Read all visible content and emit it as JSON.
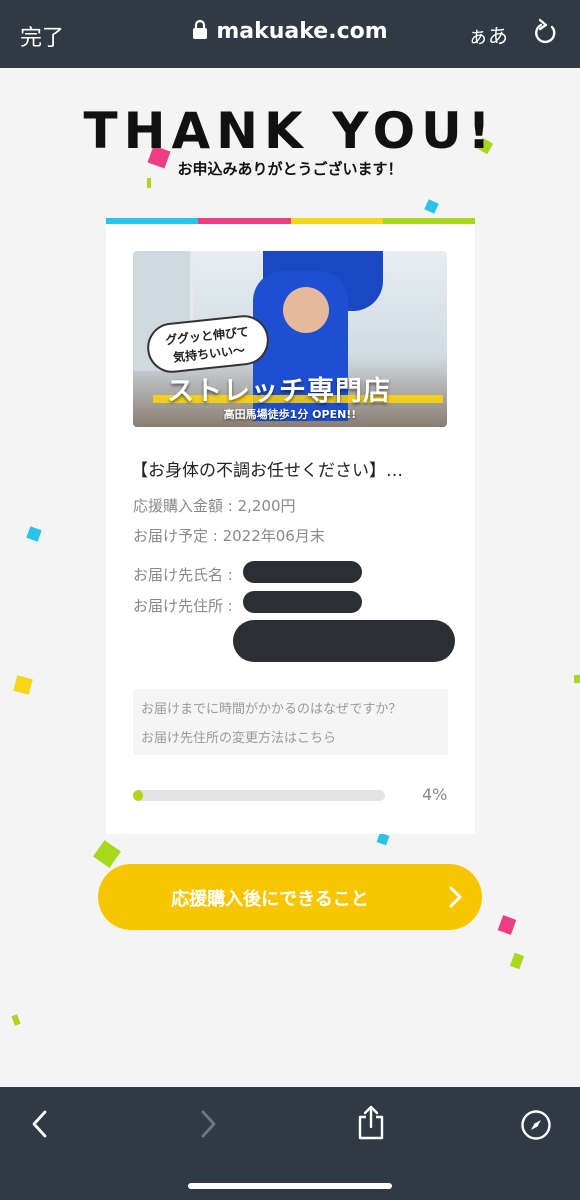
{
  "browser": {
    "done_label": "完了",
    "url": "makuake.com",
    "aa_label": "ぁあ",
    "icons": [
      "lock-icon",
      "reload-icon",
      "back-icon",
      "forward-icon",
      "share-icon",
      "compass-icon"
    ]
  },
  "heading": {
    "title": "THANK YOU!",
    "subtitle": "お申込みありがとうございます！"
  },
  "card": {
    "image": {
      "bubble_line1": "ググッと伸びて",
      "bubble_line2": "気持ちいい〜",
      "title": "ストレッチ専門店",
      "subtitle": "高田馬場徒歩1分 OPEN!!"
    },
    "project_title": "【お身体の不調お任せください】…",
    "amount": "応援購入金額 : 2,200円",
    "delivery": "お届け予定 : 2022年06月末",
    "recipient_label": "お届け先氏名 :",
    "address_label": "お届け先住所 :",
    "faq": {
      "q1": "お届けまでに時間がかかるのはなぜですか？",
      "q2": "お届け先住所の変更方法はこちら"
    },
    "progress": {
      "percent": 4,
      "label": "4%"
    }
  },
  "cta": {
    "label": "応援購入後にできること"
  },
  "colors": {
    "stripe": [
      "#29c4e8",
      "#ec3d85",
      "#f5d718",
      "#a6d81e"
    ],
    "cta": "#f8c600",
    "progress": "#b3d41a",
    "bar": "#2f3a44"
  }
}
